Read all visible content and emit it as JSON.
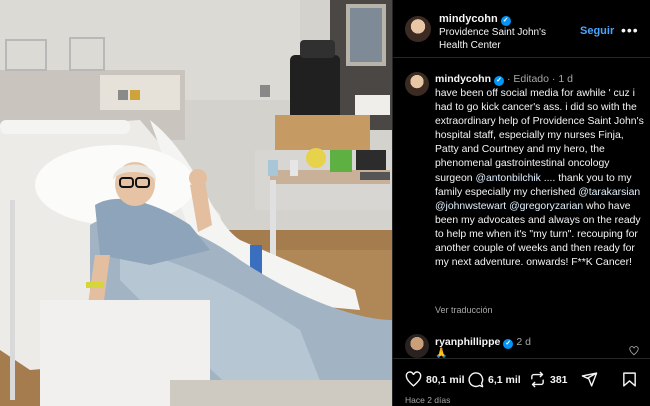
{
  "header": {
    "username": "mindycohn",
    "location": "Providence Saint John's Health Center",
    "follow_label": "Seguir",
    "more_label": "•••"
  },
  "caption": {
    "username": "mindycohn",
    "edited": "· Editado ·",
    "age": "1 d",
    "text_1": "have been off social media for awhile ' cuz i had to go kick cancer's ass.  i did so with the extraordinary help of Providence Saint John's hospital staff, especially my nurses Finja, Patty and Courtney and my hero, the phenomenal gastrointestinal oncology surgeon ",
    "mention_1": "@antonbilchik",
    "text_2": " .... thank you to my family especially my cherished ",
    "mention_2": "@tarakarsian",
    "mention_3": "@johnwstewart",
    "mention_4": "@gregoryzarian",
    "text_3": " who have been my advocates and always on the ready to help me when it's \"my turn\". recouping for another couple of weeks and then ready for my next adventure.  onwards! F**K Cancer!",
    "translate_label": "Ver traducción"
  },
  "comment": {
    "username": "ryanphillippe",
    "age": "2 d",
    "text": "🙏"
  },
  "actions": {
    "likes": "80,1 mil",
    "comments": "6,1 mil",
    "reposts": "381",
    "posted_ago": "Hace 2 días"
  },
  "colors": {
    "accent": "#0095f6",
    "follow": "#4ca5ff",
    "background": "#000000",
    "muted": "#a8a8a8"
  },
  "icons": [
    "verified-badge-icon",
    "more-icon",
    "heart-icon",
    "comment-icon",
    "repost-icon",
    "share-icon",
    "bookmark-icon"
  ]
}
